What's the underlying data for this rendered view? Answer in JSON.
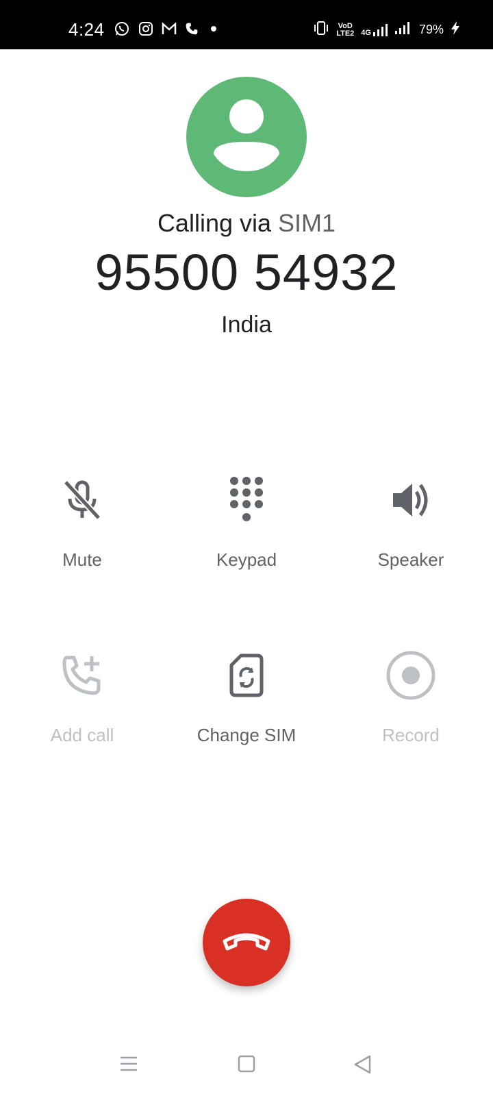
{
  "status_bar": {
    "time": "4:24",
    "notification_icons": [
      "whatsapp-icon",
      "instagram-icon",
      "gmail-icon",
      "phone-icon",
      "dot-icon"
    ],
    "volte_label_top": "VoD",
    "volte_label_bottom": "LTE2",
    "network_label": "4G",
    "battery_percent": "79%"
  },
  "caller": {
    "via_prefix": "Calling via",
    "sim_label": "SIM1",
    "number": "95500 54932",
    "region": "India",
    "avatar_color": "#5db975"
  },
  "actions": {
    "mute": "Mute",
    "keypad": "Keypad",
    "speaker": "Speaker",
    "add_call": "Add call",
    "change_sim": "Change SIM",
    "record": "Record"
  },
  "colors": {
    "end_call": "#d93025",
    "icon": "#5f6368",
    "disabled": "#bdc1c6"
  }
}
